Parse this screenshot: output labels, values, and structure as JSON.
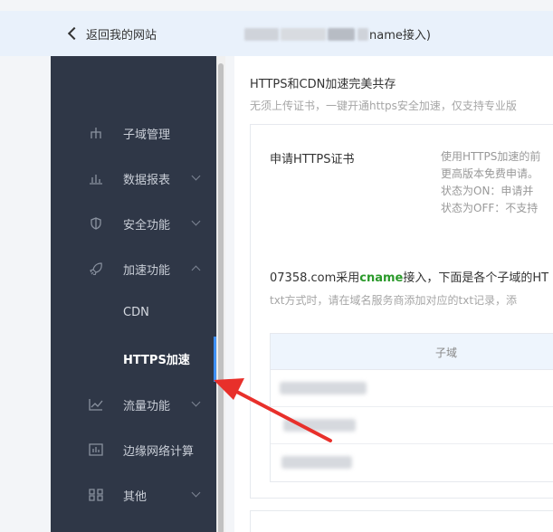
{
  "header": {
    "back_label": "返回我的网站",
    "title_suffix": "name接入)"
  },
  "sidebar": {
    "items": [
      {
        "label": "子域管理",
        "icon": "sitemap-icon",
        "caret": "none"
      },
      {
        "label": "数据报表",
        "icon": "bar-chart-icon",
        "caret": "down"
      },
      {
        "label": "安全功能",
        "icon": "shield-icon",
        "caret": "down"
      },
      {
        "label": "加速功能",
        "icon": "rocket-icon",
        "caret": "up"
      },
      {
        "label": "CDN",
        "sub": true
      },
      {
        "label": "HTTPS加速",
        "sub": true,
        "active": true
      },
      {
        "label": "流量功能",
        "icon": "line-chart-icon",
        "caret": "down"
      },
      {
        "label": "边缘网络计算",
        "icon": "chart-box-icon",
        "caret": "none"
      },
      {
        "label": "其他",
        "icon": "grid-icon",
        "caret": "down"
      }
    ]
  },
  "main": {
    "section_title": "HTTPS和CDN加速完美共存",
    "section_desc": "无须上传证书，一键开通https安全加速，仅支持专业版",
    "cert": {
      "label": "申请HTTPS证书",
      "lines": [
        "使用HTTPS加速的前",
        "更高版本免费申请。",
        "状态为ON：申请并",
        "状态为OFF：不支持"
      ]
    },
    "cname": {
      "prefix": "07358.com采用",
      "highlight": "cname",
      "suffix": "接入，下面是各个子域的HT"
    },
    "txt_note": "txt方式时，请在域名服务商添加对应的txt记录，添",
    "table": {
      "header": "子域"
    }
  },
  "colors": {
    "sidebar_bg": "#2f3747",
    "accent": "#3d8ff5",
    "highlight_green": "#2b9a2b",
    "annotation_arrow": "#e8302b"
  }
}
